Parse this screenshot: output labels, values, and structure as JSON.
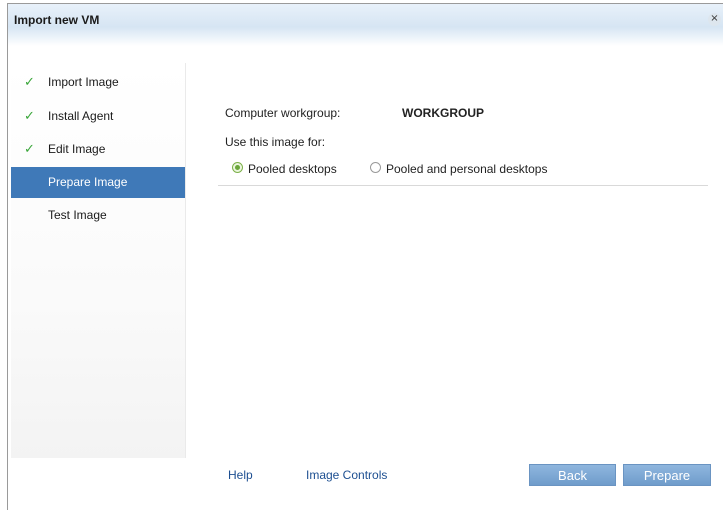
{
  "dialog": {
    "title": "Import new VM",
    "close_glyph": "×"
  },
  "steps": [
    {
      "label": "Import Image",
      "done": true
    },
    {
      "label": "Install Agent",
      "done": true
    },
    {
      "label": "Edit Image",
      "done": true
    },
    {
      "label": "Prepare Image",
      "active": true
    },
    {
      "label": "Test Image"
    }
  ],
  "check_glyph": "✓",
  "form": {
    "workgroup_label": "Computer workgroup:",
    "workgroup_value": "WORKGROUP",
    "use_label": "Use this image for:",
    "options": [
      {
        "label": "Pooled desktops",
        "selected": true
      },
      {
        "label": "Pooled and personal desktops",
        "selected": false
      }
    ]
  },
  "footer": {
    "help": "Help",
    "image_controls": "Image Controls",
    "back": "Back",
    "prepare": "Prepare"
  },
  "colors": {
    "accent": "#3f79b8",
    "check": "#3aa63a",
    "link": "#1d4f91",
    "button": "#7ea8d4"
  }
}
